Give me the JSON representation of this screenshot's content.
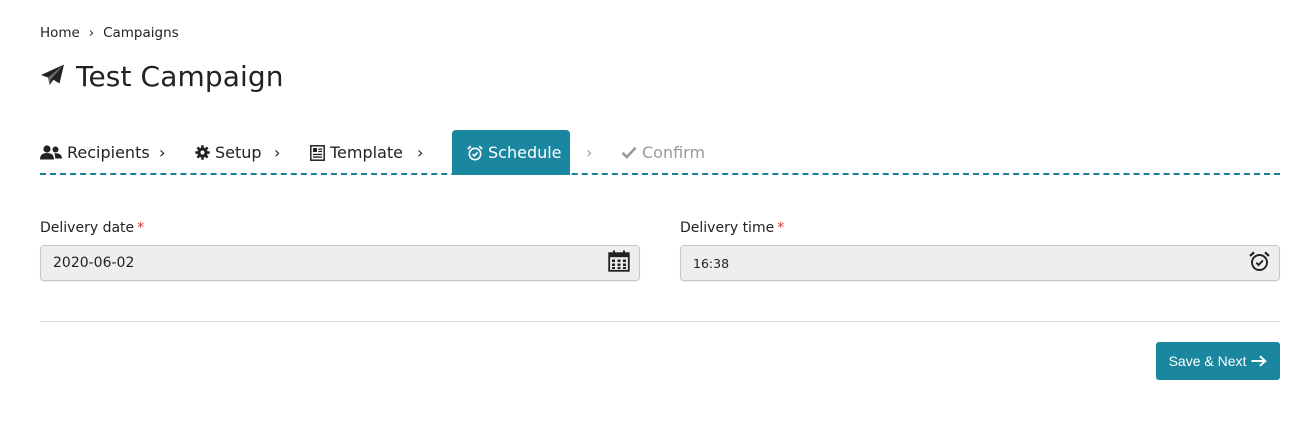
{
  "breadcrumb": {
    "home": "Home",
    "separator": "›",
    "current": "Campaigns"
  },
  "page": {
    "title": "Test Campaign",
    "icon": "paper-plane-icon"
  },
  "steps": [
    {
      "label": "Recipients",
      "icon": "users-icon",
      "state": "done"
    },
    {
      "label": "Setup",
      "icon": "gear-icon",
      "state": "done"
    },
    {
      "label": "Template",
      "icon": "template-icon",
      "state": "done"
    },
    {
      "label": "Schedule",
      "icon": "alarm-clock-icon",
      "state": "active"
    },
    {
      "label": "Confirm",
      "icon": "check-icon",
      "state": "disabled"
    }
  ],
  "step_separator": "›",
  "form": {
    "delivery_date": {
      "label": "Delivery date",
      "required_mark": "*",
      "value": "2020-06-02",
      "icon": "calendar-icon"
    },
    "delivery_time": {
      "label": "Delivery time",
      "required_mark": "*",
      "value": "16:38",
      "icon": "alarm-clock-icon"
    }
  },
  "actions": {
    "save_next_label": "Save & Next",
    "save_next_icon": "arrow-right-icon"
  },
  "colors": {
    "accent": "#1a869f",
    "required": "#dd3333",
    "field_bg": "#eeeeee",
    "disabled_text": "#9a9a9a"
  }
}
